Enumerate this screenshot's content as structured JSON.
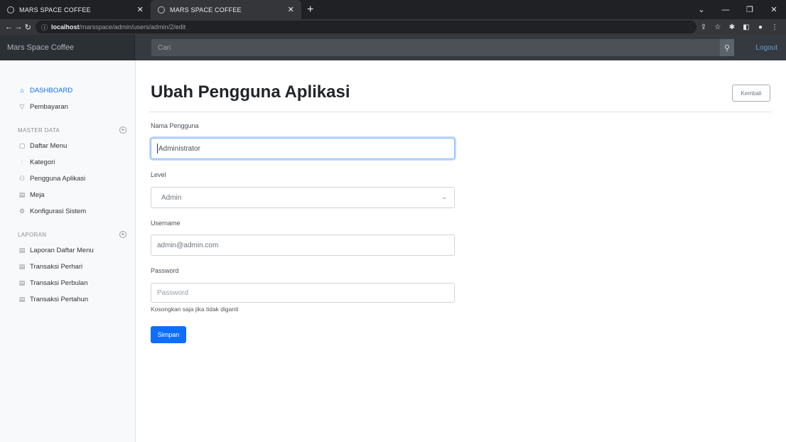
{
  "browser": {
    "tabs": [
      {
        "title": "MARS SPACE COFFEE",
        "active": false
      },
      {
        "title": "MARS SPACE COFFEE",
        "active": true
      }
    ],
    "new_tab_symbol": "+",
    "url_host": "localhost",
    "url_path": "/marsspace/admin/users/admin/2/edit"
  },
  "app": {
    "brand": "Mars Space Coffee",
    "search_placeholder": "Cari",
    "logout": "Logout"
  },
  "sidebar": {
    "items_top": [
      {
        "label": "DASHBOARD",
        "icon": "home-icon"
      },
      {
        "label": "Pembayaran",
        "icon": "cart-icon"
      }
    ],
    "master_heading": "MASTER DATA",
    "master_items": [
      {
        "label": "Daftar Menu",
        "icon": "file-icon"
      },
      {
        "label": "Kategori",
        "icon": "bar-chart-icon"
      },
      {
        "label": "Pengguna Aplikasi",
        "icon": "users-icon"
      },
      {
        "label": "Meja",
        "icon": "layers-icon"
      },
      {
        "label": "Konfigurasi Sistem",
        "icon": "gear-icon"
      }
    ],
    "report_heading": "LAPORAN",
    "report_items": [
      {
        "label": "Laporan Daftar Menu",
        "icon": "document-icon"
      },
      {
        "label": "Transaksi Perhari",
        "icon": "document-icon"
      },
      {
        "label": "Transaksi Perbulan",
        "icon": "document-icon"
      },
      {
        "label": "Transaksi Pertahun",
        "icon": "document-icon"
      }
    ]
  },
  "page": {
    "title": "Ubah Pengguna Aplikasi",
    "back_label": "Kembali"
  },
  "form": {
    "name_label": "Nama Pengguna",
    "name_value": "Administrator",
    "level_label": "Level",
    "level_value": "Admin",
    "username_label": "Username",
    "username_value": "admin@admin.com",
    "password_label": "Password",
    "password_placeholder": "Password",
    "password_hint": "Kosongkan saja jika tidak diganti",
    "submit_label": "Simpan"
  },
  "colors": {
    "primary": "#0d6efd",
    "navbar": "#343a40",
    "browser_frame": "#202124"
  }
}
